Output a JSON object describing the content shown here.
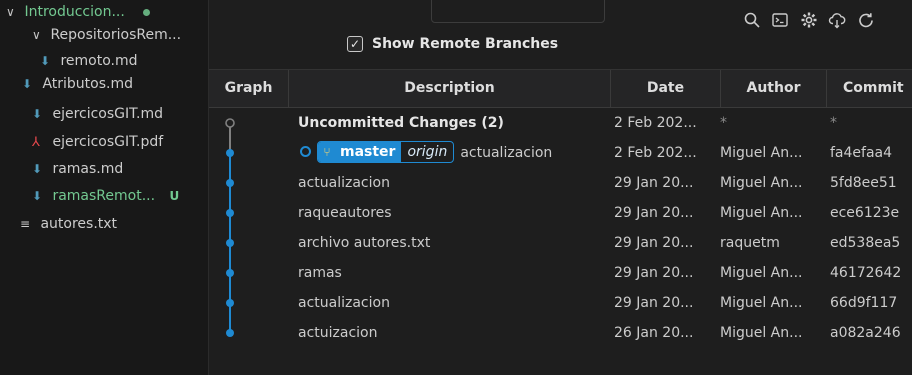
{
  "explorer": {
    "items": [
      {
        "label": "Introduccion...",
        "chevron": "∨",
        "icon": "",
        "green": true,
        "dot": true
      },
      {
        "label": "RepositoriosRem...",
        "chevron": "∨",
        "icon": ""
      },
      {
        "label": "remoto.md",
        "icon": "markdown-icon"
      },
      {
        "label": "Atributos.md",
        "icon": "markdown-icon"
      },
      {
        "label": "ejercicosGIT.md",
        "icon": "markdown-icon"
      },
      {
        "label": "ejercicosGIT.pdf",
        "icon": "pdf-icon"
      },
      {
        "label": "ramas.md",
        "icon": "markdown-icon"
      },
      {
        "label": "ramasRemot...",
        "icon": "markdown-icon",
        "green": true,
        "badge": "U"
      },
      {
        "label": "autores.txt",
        "icon": "text-file-icon"
      }
    ]
  },
  "graph": {
    "show_remote_label": "Show Remote Branches",
    "show_remote_checked": true,
    "columns": {
      "graph": "Graph",
      "description": "Description",
      "date": "Date",
      "author": "Author",
      "commit": "Commit"
    },
    "branch_badge": {
      "name": "master",
      "remote": "origin"
    },
    "rows": [
      {
        "description": "Uncommitted Changes (2)",
        "date": "2 Feb 202...",
        "author": "*",
        "commit": "*",
        "uncommitted": true
      },
      {
        "description": "actualizacion",
        "date": "2 Feb 202...",
        "author": "Miguel An...",
        "commit": "fa4efaa4",
        "head": true
      },
      {
        "description": "actualizacion",
        "date": "29 Jan 20...",
        "author": "Miguel An...",
        "commit": "5fd8ee51"
      },
      {
        "description": "raqueautores",
        "date": "29 Jan 20...",
        "author": "Miguel An...",
        "commit": "ece6123e"
      },
      {
        "description": "archivo autores.txt",
        "date": "29 Jan 20...",
        "author": "raquetm",
        "commit": "ed538ea5"
      },
      {
        "description": "ramas",
        "date": "29 Jan 20...",
        "author": "Miguel An...",
        "commit": "46172642"
      },
      {
        "description": "actualizacion",
        "date": "29 Jan 20...",
        "author": "Miguel An...",
        "commit": "66d9f117"
      },
      {
        "description": "actuizacion",
        "date": "26 Jan 20...",
        "author": "Miguel An...",
        "commit": "a082a246"
      }
    ]
  },
  "colors": {
    "graph_line": "#1f8ad2",
    "uncommitted": "#808080",
    "accent_green": "#73c991"
  },
  "toolbar_icons": [
    "search-icon",
    "terminal-icon",
    "gear-icon",
    "cloud-fetch-icon",
    "refresh-icon"
  ]
}
